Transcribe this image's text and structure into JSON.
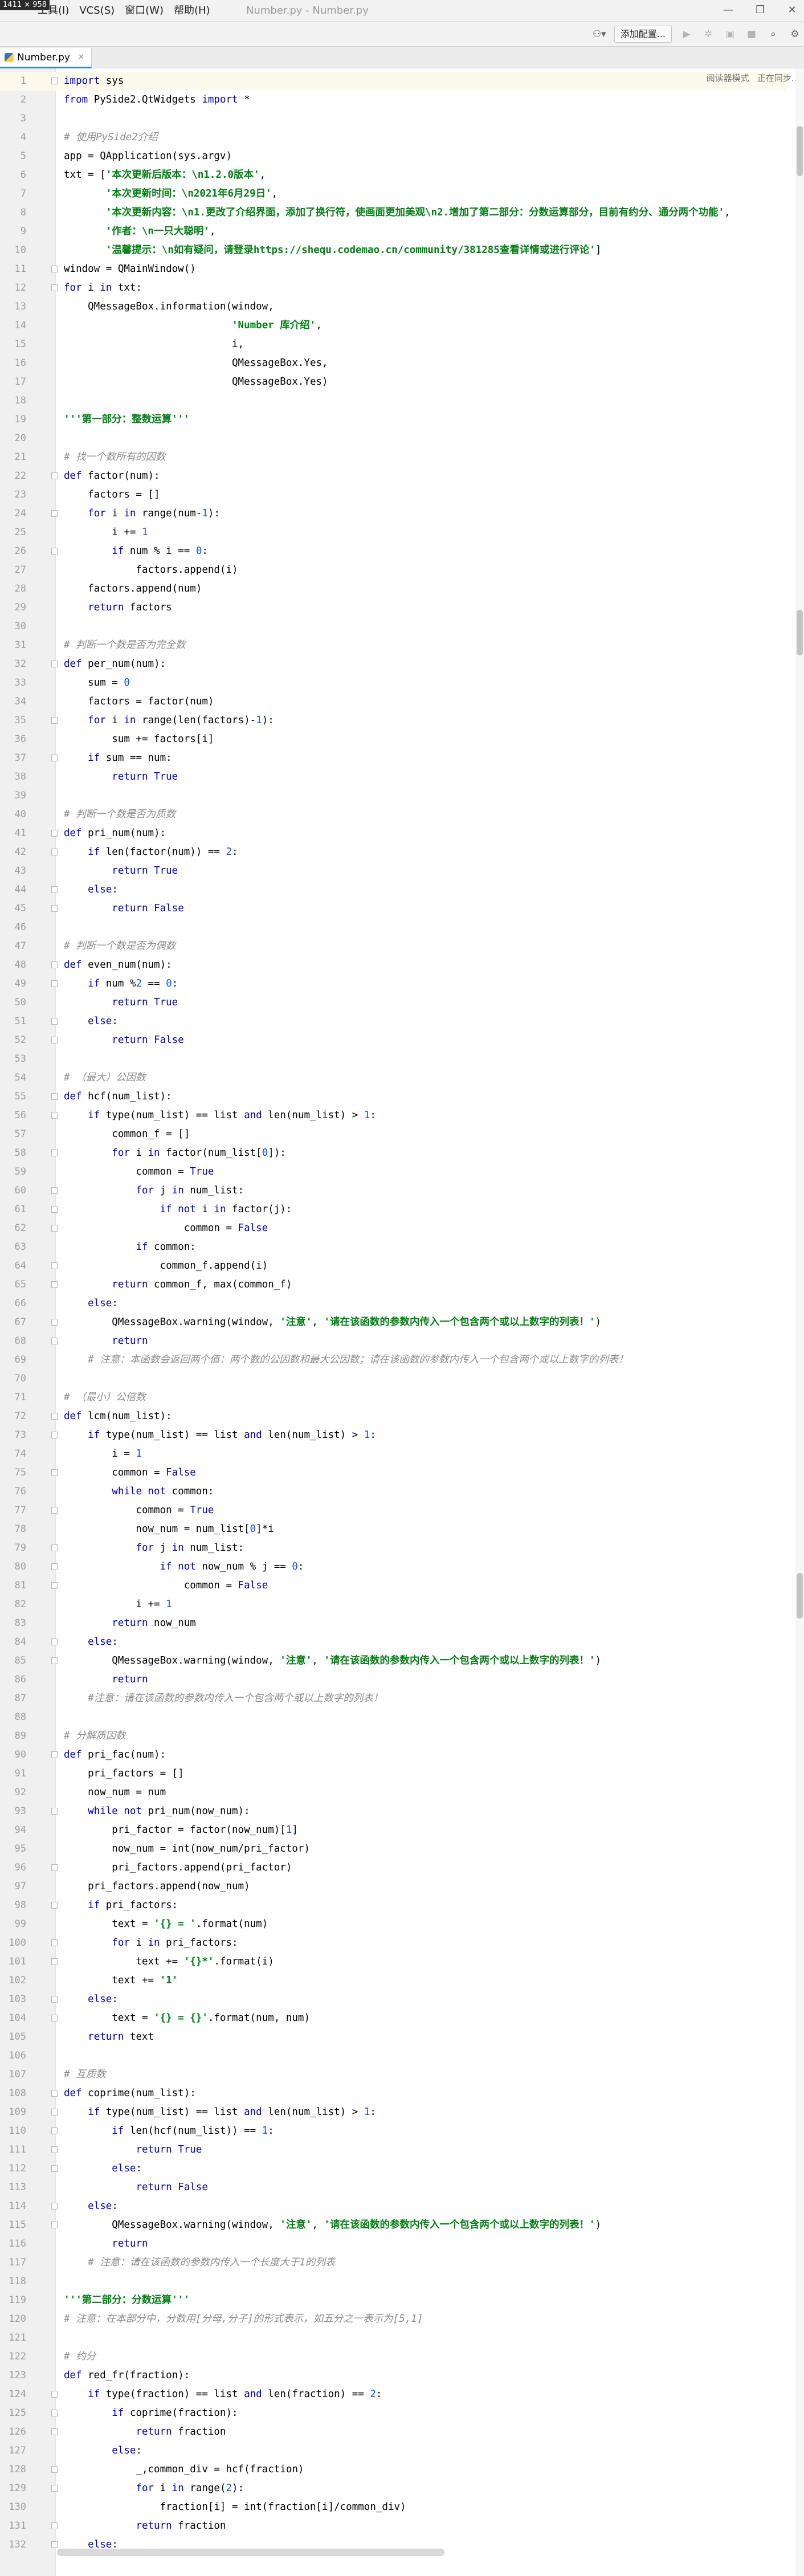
{
  "badge": "1411 × 958",
  "menu": [
    "工具(I)",
    "VCS(S)",
    "窗口(W)",
    "帮助(H)"
  ],
  "window_title": "Number.py - Number.py",
  "toolbar": {
    "user_icon": "user-icon",
    "add_config_label": "添加配置...",
    "run_icon": "run-icon",
    "debug_icon": "debug-icon",
    "coverage_icon": "coverage-icon",
    "stop_icon": "stop-icon",
    "search_icon": "search-icon",
    "settings_icon": "gear-icon"
  },
  "tab": {
    "label": "Number.py"
  },
  "reader": {
    "mode_label": "阅读器模式",
    "sync_label": "正在同步..."
  },
  "code_lines": [
    [
      {
        "t": "import",
        "c": "kw"
      },
      {
        "t": " sys"
      }
    ],
    [
      {
        "t": "from",
        "c": "kw"
      },
      {
        "t": " PySide2.QtWidgets "
      },
      {
        "t": "import",
        "c": "kw"
      },
      {
        "t": " *"
      }
    ],
    [],
    [
      {
        "t": "# 使用PySide2介绍",
        "c": "cm"
      }
    ],
    [
      {
        "t": "app = QApplication(sys.argv)"
      }
    ],
    [
      {
        "t": "txt = ["
      },
      {
        "t": "'本次更新后版本：\\n1.2.0版本'",
        "c": "str"
      },
      {
        "t": ","
      }
    ],
    [
      {
        "t": "       "
      },
      {
        "t": "'本次更新时间：\\n2021年6月29日'",
        "c": "str"
      },
      {
        "t": ","
      }
    ],
    [
      {
        "t": "       "
      },
      {
        "t": "'本次更新内容：\\n1.更改了介绍界面，添加了换行符，使画面更加美观\\n2.增加了第二部分：分数运算部分，目前有约分、通分两个功能'",
        "c": "str"
      },
      {
        "t": ","
      }
    ],
    [
      {
        "t": "       "
      },
      {
        "t": "'作者：\\n一只大聪明'",
        "c": "str"
      },
      {
        "t": ","
      }
    ],
    [
      {
        "t": "       "
      },
      {
        "t": "'温馨提示：\\n如有疑问，请登录https://shequ.codemao.cn/community/381285查看详情或进行评论'",
        "c": "str"
      },
      {
        "t": "]"
      }
    ],
    [
      {
        "t": "window = QMainWindow()"
      }
    ],
    [
      {
        "t": "for",
        "c": "kw"
      },
      {
        "t": " i "
      },
      {
        "t": "in",
        "c": "kw"
      },
      {
        "t": " txt:"
      }
    ],
    [
      {
        "t": "    QMessageBox.information(window,"
      }
    ],
    [
      {
        "t": "                            "
      },
      {
        "t": "'Number 库介绍'",
        "c": "str"
      },
      {
        "t": ","
      }
    ],
    [
      {
        "t": "                            i,"
      }
    ],
    [
      {
        "t": "                            QMessageBox.Yes,"
      }
    ],
    [
      {
        "t": "                            QMessageBox.Yes)"
      }
    ],
    [],
    [
      {
        "t": "'''第一部分：整数运算'''",
        "c": "str"
      }
    ],
    [],
    [
      {
        "t": "# 找一个数所有的因数",
        "c": "cm"
      }
    ],
    [
      {
        "t": "def",
        "c": "kw"
      },
      {
        "t": " factor(num):"
      }
    ],
    [
      {
        "t": "    factors = []"
      }
    ],
    [
      {
        "t": "    "
      },
      {
        "t": "for",
        "c": "kw"
      },
      {
        "t": " i "
      },
      {
        "t": "in",
        "c": "kw"
      },
      {
        "t": " range(num-"
      },
      {
        "t": "1",
        "c": "num"
      },
      {
        "t": "):"
      }
    ],
    [
      {
        "t": "        i += "
      },
      {
        "t": "1",
        "c": "num"
      }
    ],
    [
      {
        "t": "        "
      },
      {
        "t": "if",
        "c": "kw"
      },
      {
        "t": " num % i == "
      },
      {
        "t": "0",
        "c": "num"
      },
      {
        "t": ":"
      }
    ],
    [
      {
        "t": "            factors.append(i)"
      }
    ],
    [
      {
        "t": "    factors.append(num)"
      }
    ],
    [
      {
        "t": "    "
      },
      {
        "t": "return",
        "c": "kw"
      },
      {
        "t": " factors"
      }
    ],
    [],
    [
      {
        "t": "# 判断一个数是否为完全数",
        "c": "cm"
      }
    ],
    [
      {
        "t": "def",
        "c": "kw"
      },
      {
        "t": " per_num(num):"
      }
    ],
    [
      {
        "t": "    sum = "
      },
      {
        "t": "0",
        "c": "num"
      }
    ],
    [
      {
        "t": "    factors = factor(num)"
      }
    ],
    [
      {
        "t": "    "
      },
      {
        "t": "for",
        "c": "kw"
      },
      {
        "t": " i "
      },
      {
        "t": "in",
        "c": "kw"
      },
      {
        "t": " range(len(factors)-"
      },
      {
        "t": "1",
        "c": "num"
      },
      {
        "t": "):"
      }
    ],
    [
      {
        "t": "        sum += factors[i]"
      }
    ],
    [
      {
        "t": "    "
      },
      {
        "t": "if",
        "c": "kw"
      },
      {
        "t": " sum == num:"
      }
    ],
    [
      {
        "t": "        "
      },
      {
        "t": "return",
        "c": "kw"
      },
      {
        "t": " "
      },
      {
        "t": "True",
        "c": "kw"
      }
    ],
    [],
    [
      {
        "t": "# 判断一个数是否为质数",
        "c": "cm"
      }
    ],
    [
      {
        "t": "def",
        "c": "kw"
      },
      {
        "t": " pri_num(num):"
      }
    ],
    [
      {
        "t": "    "
      },
      {
        "t": "if",
        "c": "kw"
      },
      {
        "t": " len(factor(num)) == "
      },
      {
        "t": "2",
        "c": "num"
      },
      {
        "t": ":"
      }
    ],
    [
      {
        "t": "        "
      },
      {
        "t": "return",
        "c": "kw"
      },
      {
        "t": " "
      },
      {
        "t": "True",
        "c": "kw"
      }
    ],
    [
      {
        "t": "    "
      },
      {
        "t": "else",
        "c": "kw"
      },
      {
        "t": ":"
      }
    ],
    [
      {
        "t": "        "
      },
      {
        "t": "return",
        "c": "kw"
      },
      {
        "t": " "
      },
      {
        "t": "False",
        "c": "kw"
      }
    ],
    [],
    [
      {
        "t": "# 判断一个数是否为偶数",
        "c": "cm"
      }
    ],
    [
      {
        "t": "def",
        "c": "kw"
      },
      {
        "t": " even_num(num):"
      }
    ],
    [
      {
        "t": "    "
      },
      {
        "t": "if",
        "c": "kw"
      },
      {
        "t": " num %"
      },
      {
        "t": "2",
        "c": "num"
      },
      {
        "t": " == "
      },
      {
        "t": "0",
        "c": "num"
      },
      {
        "t": ":"
      }
    ],
    [
      {
        "t": "        "
      },
      {
        "t": "return",
        "c": "kw"
      },
      {
        "t": " "
      },
      {
        "t": "True",
        "c": "kw"
      }
    ],
    [
      {
        "t": "    "
      },
      {
        "t": "else",
        "c": "kw"
      },
      {
        "t": ":"
      }
    ],
    [
      {
        "t": "        "
      },
      {
        "t": "return",
        "c": "kw"
      },
      {
        "t": " "
      },
      {
        "t": "False",
        "c": "kw"
      }
    ],
    [],
    [
      {
        "t": "# （最大）公因数",
        "c": "cm"
      }
    ],
    [
      {
        "t": "def",
        "c": "kw"
      },
      {
        "t": " hcf(num_list):"
      }
    ],
    [
      {
        "t": "    "
      },
      {
        "t": "if",
        "c": "kw"
      },
      {
        "t": " type(num_list) == list "
      },
      {
        "t": "and",
        "c": "kw"
      },
      {
        "t": " len(num_list) > "
      },
      {
        "t": "1",
        "c": "num"
      },
      {
        "t": ":"
      }
    ],
    [
      {
        "t": "        common_f = []"
      }
    ],
    [
      {
        "t": "        "
      },
      {
        "t": "for",
        "c": "kw"
      },
      {
        "t": " i "
      },
      {
        "t": "in",
        "c": "kw"
      },
      {
        "t": " factor(num_list["
      },
      {
        "t": "0",
        "c": "num"
      },
      {
        "t": "]):"
      }
    ],
    [
      {
        "t": "            common = "
      },
      {
        "t": "True",
        "c": "kw"
      }
    ],
    [
      {
        "t": "            "
      },
      {
        "t": "for",
        "c": "kw"
      },
      {
        "t": " j "
      },
      {
        "t": "in",
        "c": "kw"
      },
      {
        "t": " num_list:"
      }
    ],
    [
      {
        "t": "                "
      },
      {
        "t": "if not",
        "c": "kw"
      },
      {
        "t": " i "
      },
      {
        "t": "in",
        "c": "kw"
      },
      {
        "t": " factor(j):"
      }
    ],
    [
      {
        "t": "                    common = "
      },
      {
        "t": "False",
        "c": "kw"
      }
    ],
    [
      {
        "t": "            "
      },
      {
        "t": "if",
        "c": "kw"
      },
      {
        "t": " common:"
      }
    ],
    [
      {
        "t": "                common_f.append(i)"
      }
    ],
    [
      {
        "t": "        "
      },
      {
        "t": "return",
        "c": "kw"
      },
      {
        "t": " common_f, max(common_f)"
      }
    ],
    [
      {
        "t": "    "
      },
      {
        "t": "else",
        "c": "kw"
      },
      {
        "t": ":"
      }
    ],
    [
      {
        "t": "        QMessageBox.warning(window, "
      },
      {
        "t": "'注意'",
        "c": "str"
      },
      {
        "t": ", "
      },
      {
        "t": "'请在该函数的参数内传入一个包含两个或以上数字的列表！'",
        "c": "str"
      },
      {
        "t": ")"
      }
    ],
    [
      {
        "t": "        "
      },
      {
        "t": "return",
        "c": "kw"
      }
    ],
    [
      {
        "t": "    "
      },
      {
        "t": "# 注意：本函数会返回两个值：两个数的公因数和最大公因数；请在该函数的参数内传入一个包含两个或以上数字的列表！",
        "c": "cm"
      }
    ],
    [],
    [
      {
        "t": "# （最小）公倍数",
        "c": "cm"
      }
    ],
    [
      {
        "t": "def",
        "c": "kw"
      },
      {
        "t": " lcm(num_list):"
      }
    ],
    [
      {
        "t": "    "
      },
      {
        "t": "if",
        "c": "kw"
      },
      {
        "t": " type(num_list) == list "
      },
      {
        "t": "and",
        "c": "kw"
      },
      {
        "t": " len(num_list) > "
      },
      {
        "t": "1",
        "c": "num"
      },
      {
        "t": ":"
      }
    ],
    [
      {
        "t": "        i = "
      },
      {
        "t": "1",
        "c": "num"
      }
    ],
    [
      {
        "t": "        common = "
      },
      {
        "t": "False",
        "c": "kw"
      }
    ],
    [
      {
        "t": "        "
      },
      {
        "t": "while not",
        "c": "kw"
      },
      {
        "t": " common:"
      }
    ],
    [
      {
        "t": "            common = "
      },
      {
        "t": "True",
        "c": "kw"
      }
    ],
    [
      {
        "t": "            now_num = num_list["
      },
      {
        "t": "0",
        "c": "num"
      },
      {
        "t": "]*i"
      }
    ],
    [
      {
        "t": "            "
      },
      {
        "t": "for",
        "c": "kw"
      },
      {
        "t": " j "
      },
      {
        "t": "in",
        "c": "kw"
      },
      {
        "t": " num_list:"
      }
    ],
    [
      {
        "t": "                "
      },
      {
        "t": "if not",
        "c": "kw"
      },
      {
        "t": " now_num % j == "
      },
      {
        "t": "0",
        "c": "num"
      },
      {
        "t": ":"
      }
    ],
    [
      {
        "t": "                    common = "
      },
      {
        "t": "False",
        "c": "kw"
      }
    ],
    [
      {
        "t": "            i += "
      },
      {
        "t": "1",
        "c": "num"
      }
    ],
    [
      {
        "t": "        "
      },
      {
        "t": "return",
        "c": "kw"
      },
      {
        "t": " now_num"
      }
    ],
    [
      {
        "t": "    "
      },
      {
        "t": "else",
        "c": "kw"
      },
      {
        "t": ":"
      }
    ],
    [
      {
        "t": "        QMessageBox.warning(window, "
      },
      {
        "t": "'注意'",
        "c": "str"
      },
      {
        "t": ", "
      },
      {
        "t": "'请在该函数的参数内传入一个包含两个或以上数字的列表！'",
        "c": "str"
      },
      {
        "t": ")"
      }
    ],
    [
      {
        "t": "        "
      },
      {
        "t": "return",
        "c": "kw"
      }
    ],
    [
      {
        "t": "    "
      },
      {
        "t": "#注意：请在该函数的参数内传入一个包含两个或以上数字的列表！",
        "c": "cm"
      }
    ],
    [],
    [
      {
        "t": "# 分解质因数",
        "c": "cm"
      }
    ],
    [
      {
        "t": "def",
        "c": "kw"
      },
      {
        "t": " pri_fac(num):"
      }
    ],
    [
      {
        "t": "    pri_factors = []"
      }
    ],
    [
      {
        "t": "    now_num = num"
      }
    ],
    [
      {
        "t": "    "
      },
      {
        "t": "while not",
        "c": "kw"
      },
      {
        "t": " pri_num(now_num):"
      }
    ],
    [
      {
        "t": "        pri_factor = factor(now_num)["
      },
      {
        "t": "1",
        "c": "num"
      },
      {
        "t": "]"
      }
    ],
    [
      {
        "t": "        now_num = int(now_num/pri_factor)"
      }
    ],
    [
      {
        "t": "        pri_factors.append(pri_factor)"
      }
    ],
    [
      {
        "t": "    pri_factors.append(now_num)"
      }
    ],
    [
      {
        "t": "    "
      },
      {
        "t": "if",
        "c": "kw"
      },
      {
        "t": " pri_factors:"
      }
    ],
    [
      {
        "t": "        text = "
      },
      {
        "t": "'{} = '",
        "c": "str"
      },
      {
        "t": ".format(num)"
      }
    ],
    [
      {
        "t": "        "
      },
      {
        "t": "for",
        "c": "kw"
      },
      {
        "t": " i "
      },
      {
        "t": "in",
        "c": "kw"
      },
      {
        "t": " pri_factors:"
      }
    ],
    [
      {
        "t": "            text += "
      },
      {
        "t": "'{}*'",
        "c": "str"
      },
      {
        "t": ".format(i)"
      }
    ],
    [
      {
        "t": "        text += "
      },
      {
        "t": "'1'",
        "c": "str"
      }
    ],
    [
      {
        "t": "    "
      },
      {
        "t": "else",
        "c": "kw"
      },
      {
        "t": ":"
      }
    ],
    [
      {
        "t": "        text = "
      },
      {
        "t": "'{} = {}'",
        "c": "str"
      },
      {
        "t": ".format(num, num)"
      }
    ],
    [
      {
        "t": "    "
      },
      {
        "t": "return",
        "c": "kw"
      },
      {
        "t": " text"
      }
    ],
    [],
    [
      {
        "t": "# 互质数",
        "c": "cm"
      }
    ],
    [
      {
        "t": "def",
        "c": "kw"
      },
      {
        "t": " coprime(num_list):"
      }
    ],
    [
      {
        "t": "    "
      },
      {
        "t": "if",
        "c": "kw"
      },
      {
        "t": " type(num_list) == list "
      },
      {
        "t": "and",
        "c": "kw"
      },
      {
        "t": " len(num_list) > "
      },
      {
        "t": "1",
        "c": "num"
      },
      {
        "t": ":"
      }
    ],
    [
      {
        "t": "        "
      },
      {
        "t": "if",
        "c": "kw"
      },
      {
        "t": " len(hcf(num_list)) == "
      },
      {
        "t": "1",
        "c": "num"
      },
      {
        "t": ":"
      }
    ],
    [
      {
        "t": "            "
      },
      {
        "t": "return",
        "c": "kw"
      },
      {
        "t": " "
      },
      {
        "t": "True",
        "c": "kw"
      }
    ],
    [
      {
        "t": "        "
      },
      {
        "t": "else",
        "c": "kw"
      },
      {
        "t": ":"
      }
    ],
    [
      {
        "t": "            "
      },
      {
        "t": "return",
        "c": "kw"
      },
      {
        "t": " "
      },
      {
        "t": "False",
        "c": "kw"
      }
    ],
    [
      {
        "t": "    "
      },
      {
        "t": "else",
        "c": "kw"
      },
      {
        "t": ":"
      }
    ],
    [
      {
        "t": "        QMessageBox.warning(window, "
      },
      {
        "t": "'注意'",
        "c": "str"
      },
      {
        "t": ", "
      },
      {
        "t": "'请在该函数的参数内传入一个包含两个或以上数字的列表！'",
        "c": "str"
      },
      {
        "t": ")"
      }
    ],
    [
      {
        "t": "        "
      },
      {
        "t": "return",
        "c": "kw"
      }
    ],
    [
      {
        "t": "    "
      },
      {
        "t": "# 注意：请在该函数的参数内传入一个长度大于1的列表",
        "c": "cm"
      }
    ],
    [],
    [
      {
        "t": "'''第二部分：分数运算'''",
        "c": "str"
      }
    ],
    [
      {
        "t": "# 注意：在本部分中，分数用[分母,分子]的形式表示，如五分之一表示为[5,1]",
        "c": "cm"
      }
    ],
    [],
    [
      {
        "t": "# 约分",
        "c": "cm"
      }
    ],
    [
      {
        "t": "def",
        "c": "kw"
      },
      {
        "t": " red_fr(fraction):"
      }
    ],
    [
      {
        "t": "    "
      },
      {
        "t": "if",
        "c": "kw"
      },
      {
        "t": " type(fraction) == list "
      },
      {
        "t": "and",
        "c": "kw"
      },
      {
        "t": " len(fraction) == "
      },
      {
        "t": "2",
        "c": "num"
      },
      {
        "t": ":"
      }
    ],
    [
      {
        "t": "        "
      },
      {
        "t": "if",
        "c": "kw"
      },
      {
        "t": " coprime(fraction):"
      }
    ],
    [
      {
        "t": "            "
      },
      {
        "t": "return",
        "c": "kw"
      },
      {
        "t": " fraction"
      }
    ],
    [
      {
        "t": "        "
      },
      {
        "t": "else",
        "c": "kw"
      },
      {
        "t": ":"
      }
    ],
    [
      {
        "t": "            _,common_div = hcf(fraction)"
      }
    ],
    [
      {
        "t": "            "
      },
      {
        "t": "for",
        "c": "kw"
      },
      {
        "t": " i "
      },
      {
        "t": "in",
        "c": "kw"
      },
      {
        "t": " range("
      },
      {
        "t": "2",
        "c": "num"
      },
      {
        "t": "):"
      }
    ],
    [
      {
        "t": "                fraction[i] = int(fraction[i]/common_div)"
      }
    ],
    [
      {
        "t": "            "
      },
      {
        "t": "return",
        "c": "kw"
      },
      {
        "t": " fraction"
      }
    ],
    [
      {
        "t": "    "
      },
      {
        "t": "else",
        "c": "kw"
      },
      {
        "t": ":"
      }
    ]
  ],
  "fold_lines": [
    1,
    11,
    12,
    22,
    24,
    26,
    32,
    35,
    37,
    41,
    42,
    44,
    45,
    48,
    49,
    51,
    52,
    55,
    56,
    58,
    60,
    61,
    62,
    64,
    65,
    67,
    68,
    72,
    73,
    75,
    77,
    79,
    80,
    81,
    84,
    85,
    90,
    93,
    96,
    98,
    100,
    101,
    103,
    104,
    108,
    109,
    110,
    111,
    112,
    114,
    115,
    124,
    125,
    126,
    128,
    129,
    131,
    132
  ],
  "current_line": 1,
  "scroll": {
    "vertical_thumbs": [
      0.023,
      0.216,
      0.6
    ]
  }
}
